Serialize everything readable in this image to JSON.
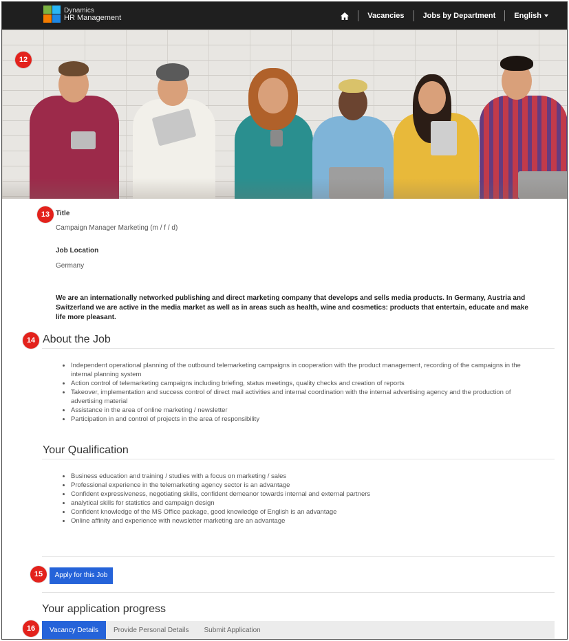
{
  "nav": {
    "brand_line1": "Dynamics",
    "brand_line2": "HR Management",
    "home_icon": "home-icon",
    "items": [
      "Vacancies",
      "Jobs by Department"
    ],
    "language": "English"
  },
  "markers": [
    "12",
    "13",
    "14",
    "15",
    "16"
  ],
  "job": {
    "title_label": "Title",
    "title_value": "Campaign Manager Marketing (m / f / d)",
    "location_label": "Job Location",
    "location_value": "Germany",
    "intro": "We are an internationally networked publishing and direct marketing company that develops and sells media products. In Germany, Austria and Switzerland we are active in the media market as well as in areas such as health, wine and cosmetics: products that entertain, educate and make life more pleasant."
  },
  "about": {
    "heading": "About the Job",
    "items": [
      "Independent operational planning of the outbound telemarketing campaigns in cooperation with the product management, recording of the campaigns in the internal planning system",
      "Action control of telemarketing campaigns including briefing, status meetings, quality checks and creation of reports",
      "Takeover, implementation and success control of direct mail activities and internal coordination with the internal advertising agency and the production of advertising material",
      "Assistance in the area of online marketing / newsletter",
      "Participation in and control of projects in the area of responsibility"
    ]
  },
  "qualification": {
    "heading": "Your Qualification",
    "items": [
      "Business education and training / studies with a focus on marketing / sales",
      "Professional experience in the telemarketing agency sector is an advantage",
      "Confident expressiveness, negotiating skills, confident demeanor towards internal and external partners",
      "analytical skills for statistics and campaign design",
      "Confident knowledge of the MS Office package, good knowledge of English is an advantage",
      "Online affinity and experience with newsletter marketing are an advantage"
    ]
  },
  "apply_label": "Apply for this Job",
  "progress": {
    "heading": "Your application progress",
    "steps": [
      "Vacancy Details",
      "Provide Personal Details",
      "Submit Application"
    ],
    "active_step": "Vacancy Details"
  },
  "colors": {
    "accent": "#2563d9",
    "marker": "#e3221c",
    "navbar": "#1f1f1f"
  }
}
